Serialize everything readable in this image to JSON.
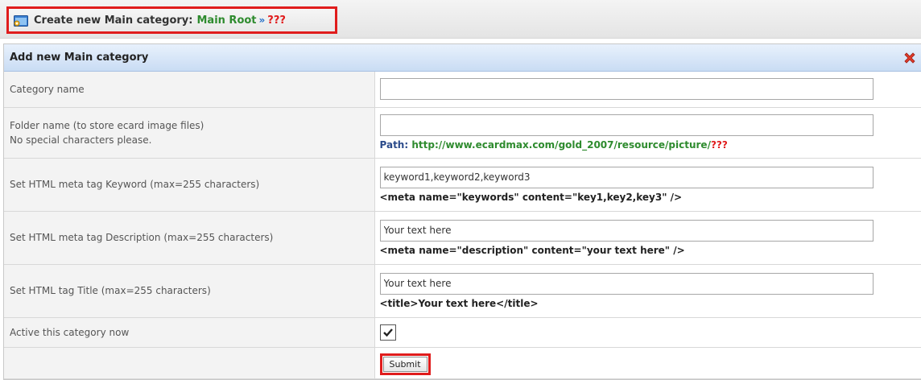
{
  "header": {
    "title": "Create new Main category:",
    "root_label": "Main Root",
    "arrows": "»",
    "unknown": "???"
  },
  "panel": {
    "title": "Add new Main category"
  },
  "form": {
    "category_name": {
      "label": "Category name",
      "value": ""
    },
    "folder_name": {
      "label_line1": "Folder name (to store ecard image files)",
      "label_line2": "No special characters please.",
      "value": "",
      "path_label": "Path:",
      "path_url": "http://www.ecardmax.com/gold_2007/resource/picture/",
      "path_unknown": "???"
    },
    "meta_keyword": {
      "label": "Set HTML meta tag Keyword (max=255 characters)",
      "value": "keyword1,keyword2,keyword3",
      "hint": "<meta name=\"keywords\" content=\"key1,key2,key3\" />"
    },
    "meta_description": {
      "label": "Set HTML meta tag Description (max=255 characters)",
      "value": "Your text here",
      "hint": "<meta name=\"description\" content=\"your text here\" />"
    },
    "html_title": {
      "label": "Set HTML tag Title (max=255 characters)",
      "value": "Your text here",
      "hint": "<title>Your text here</title>"
    },
    "active": {
      "label": "Active this category now",
      "checked": true
    },
    "submit_label": "Submit"
  },
  "icons": {
    "header_icon": "folder-icon",
    "close_icon": "close-icon"
  },
  "colors": {
    "highlight_border": "#e01c1c",
    "root_green": "#2e8b2e",
    "panel_header_blue": "#c9dcf4"
  }
}
